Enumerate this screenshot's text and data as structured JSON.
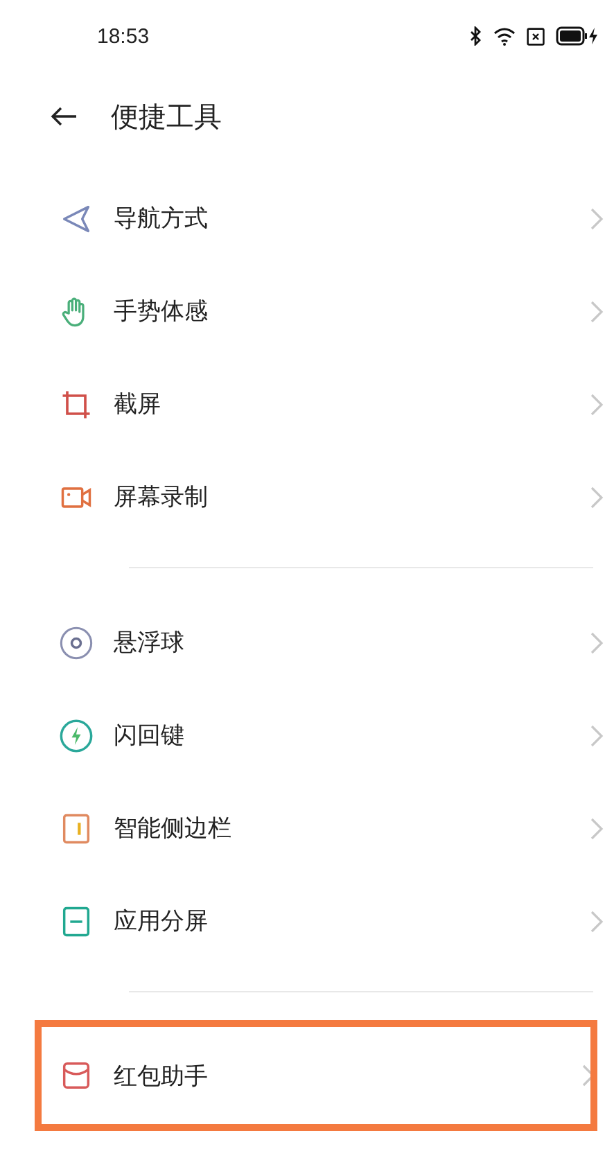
{
  "status_bar": {
    "time": "18:53"
  },
  "header": {
    "title": "便捷工具"
  },
  "groups": [
    {
      "items": [
        {
          "label": "导航方式",
          "highlighted": false
        },
        {
          "label": "手势体感",
          "highlighted": false
        },
        {
          "label": "截屏",
          "highlighted": false
        },
        {
          "label": "屏幕录制",
          "highlighted": false
        }
      ]
    },
    {
      "items": [
        {
          "label": "悬浮球",
          "highlighted": false
        },
        {
          "label": "闪回键",
          "highlighted": false
        },
        {
          "label": "智能侧边栏",
          "highlighted": false
        },
        {
          "label": "应用分屏",
          "highlighted": false
        }
      ]
    },
    {
      "items": [
        {
          "label": "红包助手",
          "highlighted": true
        }
      ]
    }
  ]
}
